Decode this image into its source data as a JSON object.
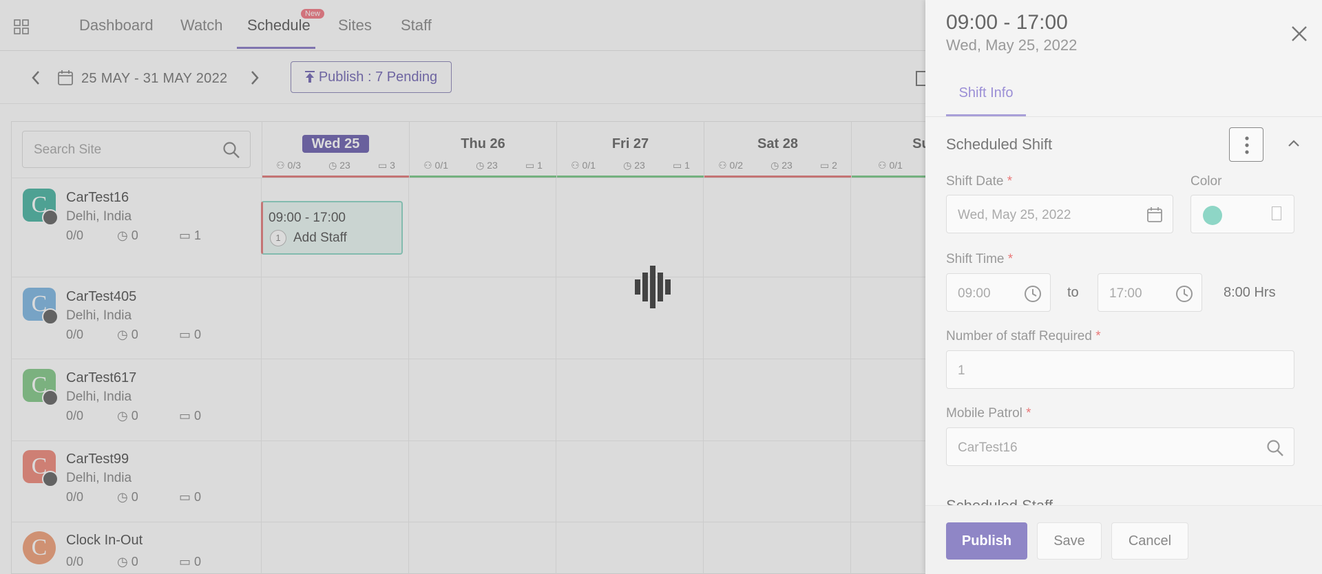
{
  "nav": {
    "tabs": [
      "Dashboard",
      "Watch",
      "Schedule",
      "Sites",
      "Staff"
    ],
    "active": "Schedule",
    "new_badge": "New"
  },
  "toolbar": {
    "date_range": "25 MAY - 31 MAY 2022",
    "publish_label": "Publish : 7 Pending"
  },
  "search": {
    "placeholder": "Search Site"
  },
  "days": [
    {
      "label": "Wed 25",
      "staff": "0/3",
      "hours": "23",
      "shifts": "3",
      "today": true,
      "status_color": "#e27b7b"
    },
    {
      "label": "Thu 26",
      "staff": "0/1",
      "hours": "23",
      "shifts": "1",
      "status_color": "#7cc98a"
    },
    {
      "label": "Fri 27",
      "staff": "0/1",
      "hours": "23",
      "shifts": "1",
      "status_color": "#7cc98a"
    },
    {
      "label": "Sat 28",
      "staff": "0/2",
      "hours": "23",
      "shifts": "2",
      "status_color": "#e27b7b"
    },
    {
      "label": "Sun",
      "staff": "0/1",
      "status_color": "#7cc98a"
    }
  ],
  "sites": [
    {
      "name": "CarTest16",
      "location": "Delhi, India",
      "staff": "0/0",
      "hours": "0",
      "shifts": "1",
      "avatar_color": "#4bb5a3"
    },
    {
      "name": "CarTest405",
      "location": "Delhi, India",
      "staff": "0/0",
      "hours": "0",
      "shifts": "0",
      "avatar_color": "#7fb8e3"
    },
    {
      "name": "CarTest617",
      "location": "Delhi, India",
      "staff": "0/0",
      "hours": "0",
      "shifts": "0",
      "avatar_color": "#84c98a"
    },
    {
      "name": "CarTest99",
      "location": "Delhi, India",
      "staff": "0/0",
      "hours": "0",
      "shifts": "0",
      "avatar_color": "#ef8a7c"
    },
    {
      "name": "Clock In-Out",
      "staff": "0/0",
      "hours": "0",
      "shifts": "0",
      "avatar_color": "#f0a07a"
    }
  ],
  "shift_card": {
    "time": "09:00 - 17:00",
    "count": "1",
    "action": "Add Staff"
  },
  "avatar_letter": "C",
  "panel": {
    "title": "09:00 - 17:00",
    "subtitle": "Wed, May 25, 2022",
    "tab": "Shift Info",
    "section": "Scheduled Shift",
    "shift_date_label": "Shift Date",
    "shift_date": "Wed, May 25, 2022",
    "color_label": "Color",
    "shift_color": "#8ed6c6",
    "shift_time_label": "Shift Time",
    "start": "09:00",
    "to": "to",
    "end": "17:00",
    "duration": "8:00 Hrs",
    "staff_required_label": "Number of staff Required",
    "staff_required": "1",
    "mobile_patrol_label": "Mobile Patrol",
    "mobile_patrol": "CarTest16",
    "next_section": "Scheduled Staff",
    "required_mark": "*"
  },
  "footer": {
    "publish": "Publish",
    "save": "Save",
    "cancel": "Cancel"
  }
}
